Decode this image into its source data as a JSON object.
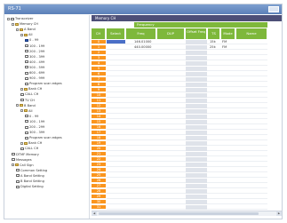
{
  "window": {
    "title": "RS-71"
  },
  "tree": [
    "Transceiver",
    "Memory CH",
    "A Band",
    "All",
    "0 - 99",
    "100 - 199",
    "200 - 299",
    "300 - 399",
    "400 - 499",
    "500 - 599",
    "600 - 699",
    "900 - 999",
    "Program scan edges",
    "Bank CH",
    "CALL CH",
    "TV CH",
    "B Band",
    "All",
    "0 - 99",
    "100 - 199",
    "200 - 299",
    "300 - 399",
    "Program scan edges",
    "Bank CH",
    "CALL CH",
    "DTMF Memory",
    "Messages",
    "Call Sign",
    "Common Setting",
    "A Band Setting",
    "B Band Setting",
    "Digital Setting"
  ],
  "grid": {
    "title": "Memory CH",
    "group_header": "Frequency",
    "columns": [
      "CH",
      "Select",
      "Freq",
      "DUP",
      "Offset Freq",
      "TS",
      "Mode",
      "Name"
    ],
    "rows": [
      {
        "ch": "0",
        "freq": "146.01000",
        "ts": "15k",
        "mode": "FM"
      },
      {
        "ch": "1",
        "freq": "440.00000",
        "ts": "25k",
        "mode": "FM"
      },
      {
        "ch": "2"
      },
      {
        "ch": "3"
      },
      {
        "ch": "4"
      },
      {
        "ch": "5"
      },
      {
        "ch": "6"
      },
      {
        "ch": "7"
      },
      {
        "ch": "8"
      },
      {
        "ch": "9"
      },
      {
        "ch": "10"
      },
      {
        "ch": "11"
      },
      {
        "ch": "12"
      },
      {
        "ch": "13"
      },
      {
        "ch": "14"
      },
      {
        "ch": "15"
      },
      {
        "ch": "16"
      },
      {
        "ch": "17"
      },
      {
        "ch": "18"
      },
      {
        "ch": "19"
      },
      {
        "ch": "20"
      },
      {
        "ch": "21"
      },
      {
        "ch": "22"
      },
      {
        "ch": "23"
      },
      {
        "ch": "24"
      },
      {
        "ch": "25"
      },
      {
        "ch": "26"
      },
      {
        "ch": "27"
      },
      {
        "ch": "28"
      },
      {
        "ch": "29"
      },
      {
        "ch": "30"
      },
      {
        "ch": "31"
      }
    ]
  },
  "colors": {
    "title_bar": "#5b80b8",
    "grid_title": "#4d4f77",
    "header_green": "#7eb83b",
    "row_number_orange": "#fa951e",
    "selection_blue": "#4a6fc7"
  }
}
